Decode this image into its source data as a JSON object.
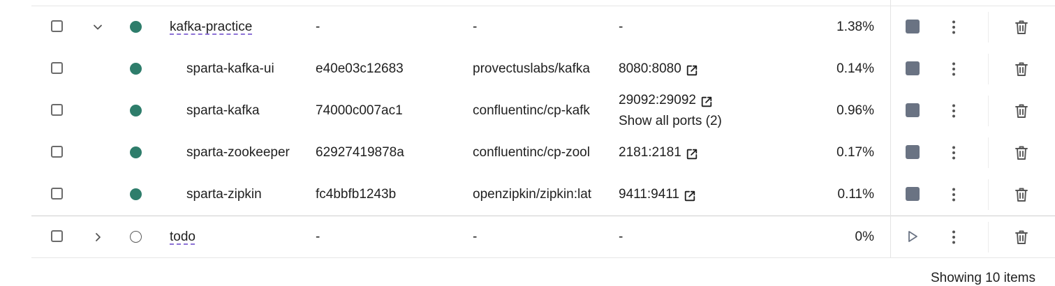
{
  "table": {
    "rows": [
      {
        "kind": "group",
        "expanded": true,
        "status": "running",
        "name": "kafka-practice",
        "container_id": "-",
        "image": "-",
        "ports": [
          "-"
        ],
        "more_ports": "",
        "cpu": "1.38%",
        "action": "stop"
      },
      {
        "kind": "child",
        "status": "running",
        "name": "sparta-kafka-ui",
        "container_id": "e40e03c12683",
        "image": "provectuslabs/kafka",
        "ports": [
          "8080:8080"
        ],
        "more_ports": "",
        "cpu": "0.14%",
        "action": "stop"
      },
      {
        "kind": "child",
        "status": "running",
        "name": "sparta-kafka",
        "container_id": "74000c007ac1",
        "image": "confluentinc/cp-kafk",
        "ports": [
          "29092:29092"
        ],
        "more_ports": "Show all ports (2)",
        "cpu": "0.96%",
        "action": "stop"
      },
      {
        "kind": "child",
        "status": "running",
        "name": "sparta-zookeeper",
        "container_id": "62927419878a",
        "image": "confluentinc/cp-zool",
        "ports": [
          "2181:2181"
        ],
        "more_ports": "",
        "cpu": "0.17%",
        "action": "stop"
      },
      {
        "kind": "child",
        "status": "running",
        "name": "sparta-zipkin",
        "container_id": "fc4bbfb1243b",
        "image": "openzipkin/zipkin:lat",
        "ports": [
          "9411:9411"
        ],
        "more_ports": "",
        "cpu": "0.11%",
        "action": "stop"
      },
      {
        "kind": "group",
        "expanded": false,
        "status": "stopped",
        "name": "todo",
        "container_id": "-",
        "image": "-",
        "ports": [
          "-"
        ],
        "more_ports": "",
        "cpu": "0%",
        "action": "start"
      }
    ]
  },
  "footer": {
    "showing": "Showing 10 items"
  },
  "colors": {
    "running": "#2e7d6b",
    "stop_button": "#6a7383",
    "group_underline": "#8d72d6"
  },
  "icons": {
    "expand": "chevron-down-icon",
    "collapse": "chevron-right-icon",
    "external": "external-link-icon",
    "stop": "stop-icon",
    "start": "play-icon",
    "more": "kebab-menu-icon",
    "delete": "trash-icon"
  }
}
